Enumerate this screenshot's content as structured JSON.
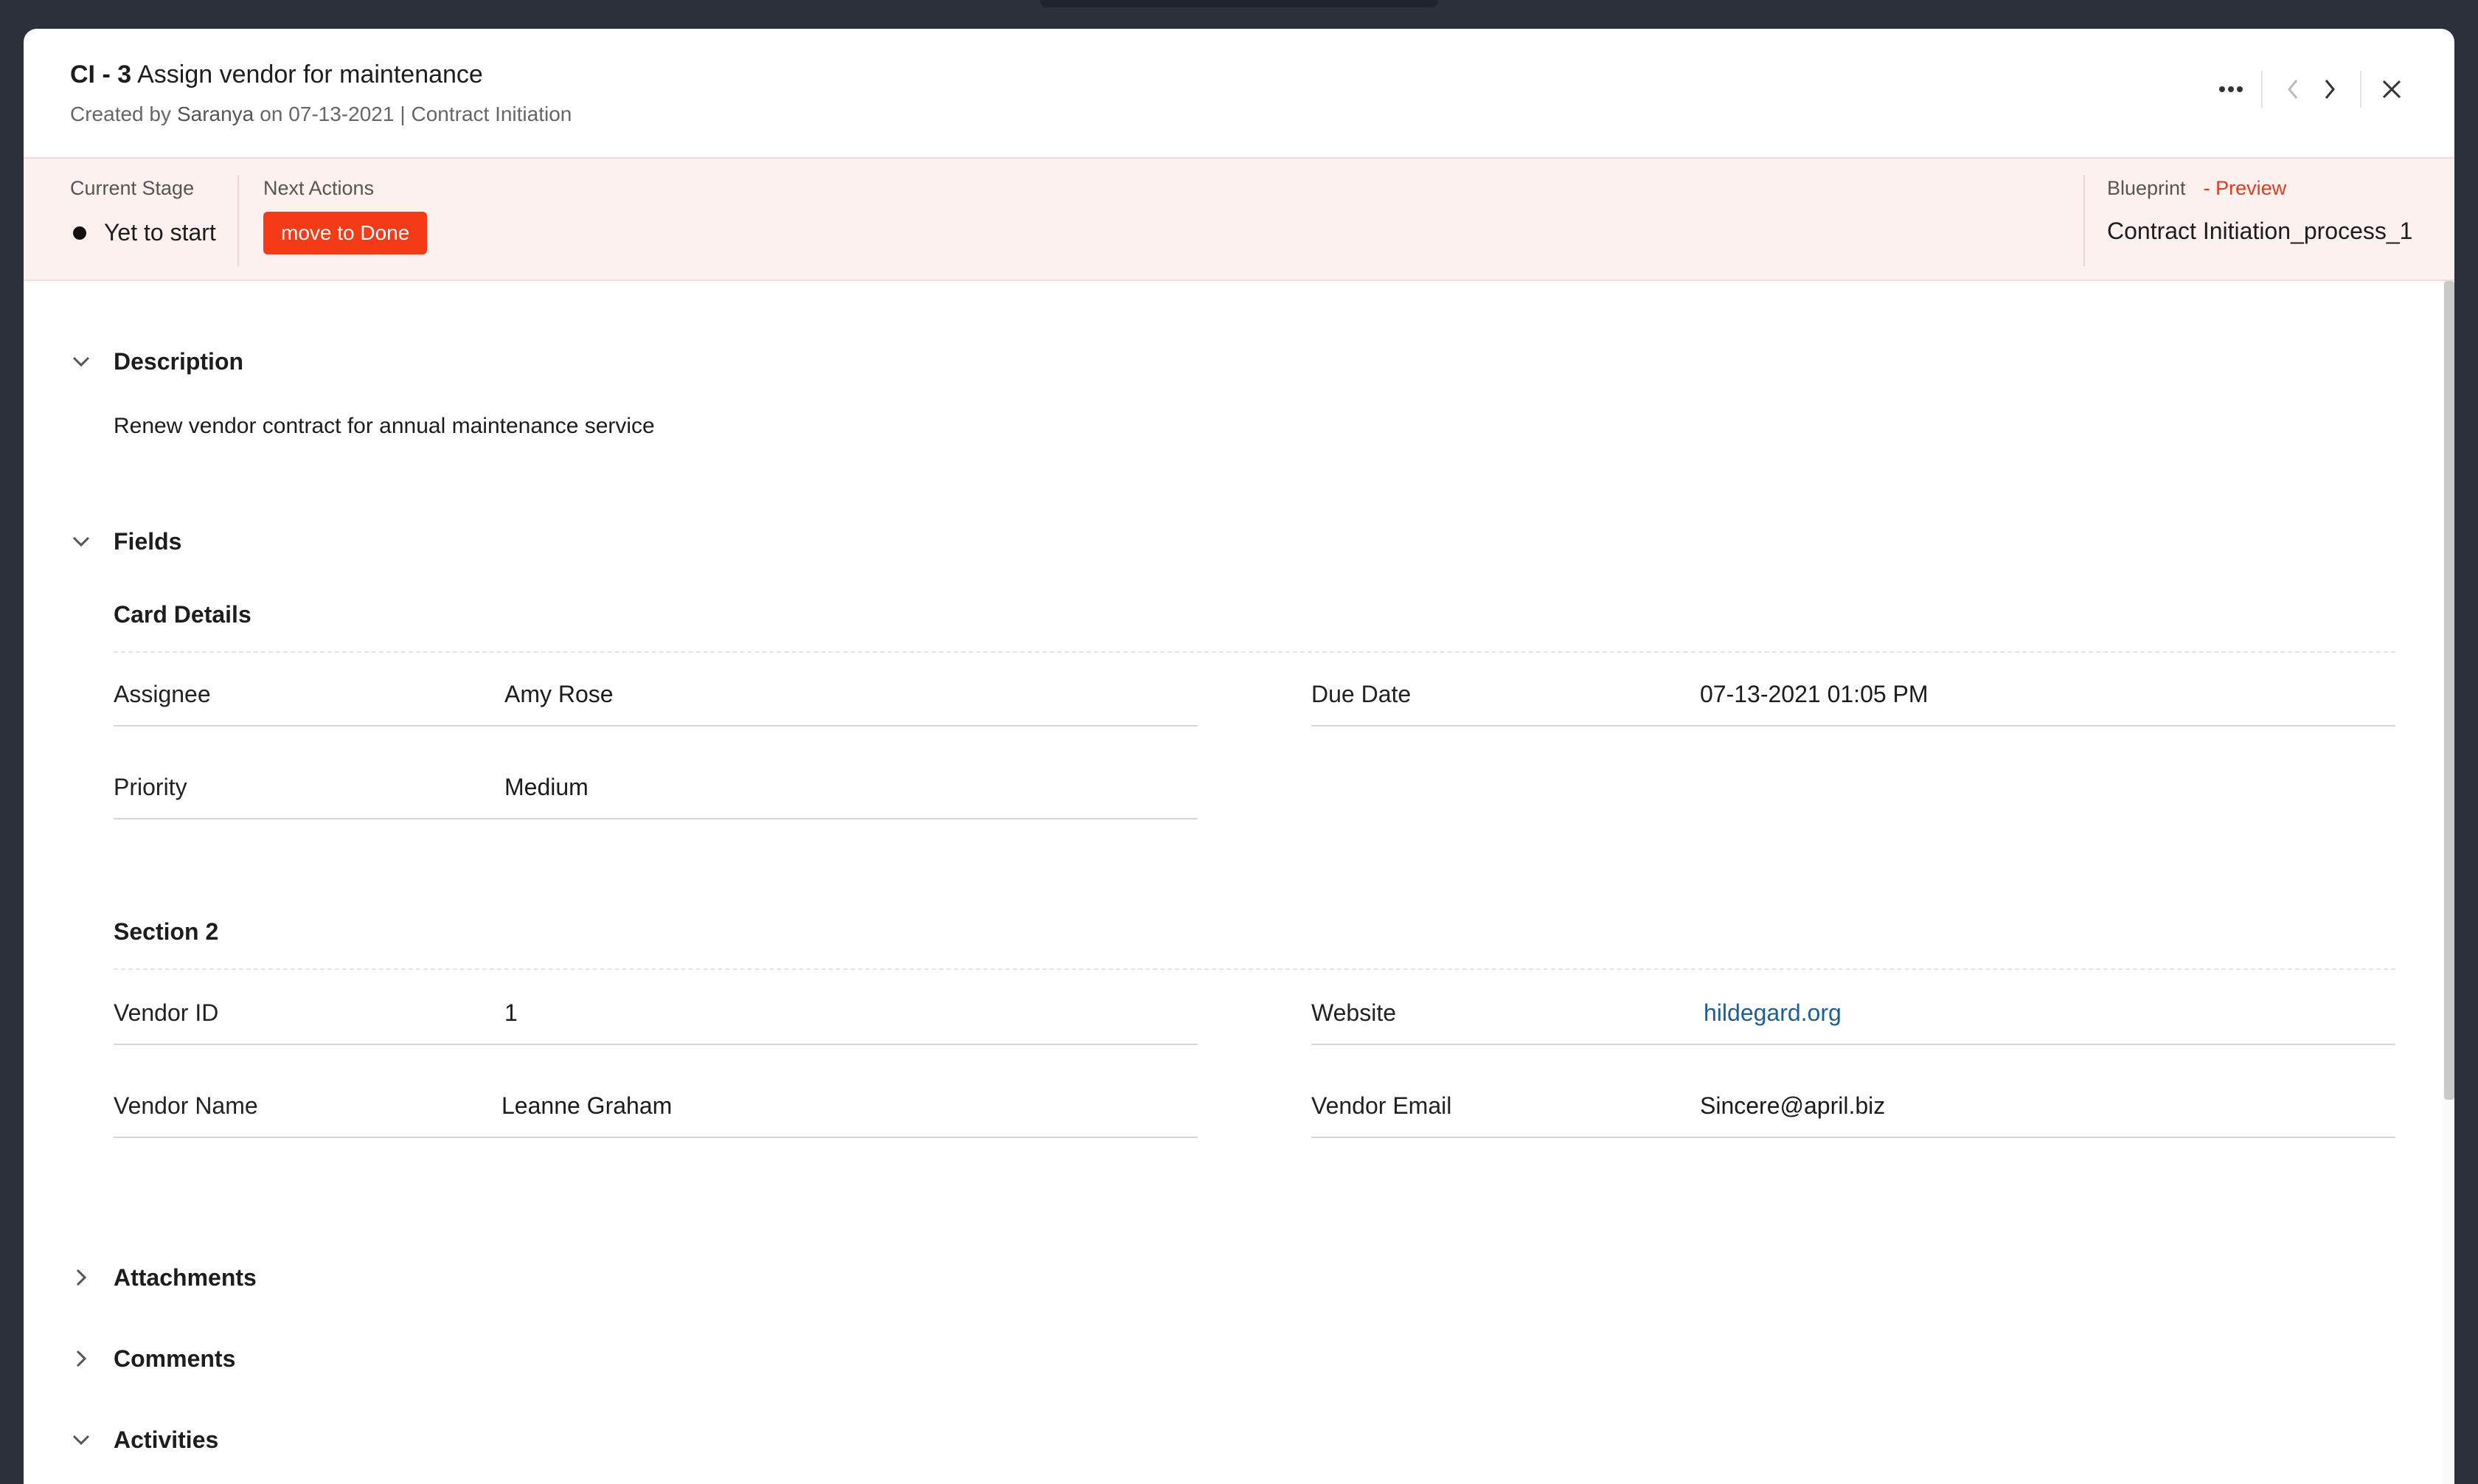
{
  "header": {
    "key": "CI - 3",
    "title": "Assign vendor for maintenance",
    "created_by_label": "Created by",
    "author": "Saranya",
    "date_text": "on 07-13-2021",
    "module": "| Contract Initiation",
    "icons": {
      "more": "more-dots-icon",
      "prev": "chevron-left-icon",
      "next": "chevron-right-icon",
      "close": "close-icon"
    }
  },
  "blueprint_band": {
    "current_stage_label": "Current Stage",
    "current_stage_value": "Yet to start",
    "next_actions_label": "Next Actions",
    "action_button": "move to Done",
    "blueprint_label": "Blueprint",
    "preview_label": "- Preview",
    "blueprint_name": "Contract Initiation_process_1",
    "colors": {
      "band_bg": "#fdf1ef",
      "button_bg": "#f43a16",
      "preview": "#e03c1c"
    }
  },
  "description": {
    "heading": "Description",
    "text": "Renew vendor contract for annual maintenance service"
  },
  "fields": {
    "heading": "Fields",
    "card_details": {
      "heading": "Card Details",
      "assignee_label": "Assignee",
      "assignee_value": "Amy Rose",
      "due_date_label": "Due Date",
      "due_date_value": "07-13-2021 01:05 PM",
      "priority_label": "Priority",
      "priority_value": "Medium"
    },
    "section2": {
      "heading": "Section 2",
      "vendor_id_label": "Vendor ID",
      "vendor_id_value": "1",
      "website_label": "Website",
      "website_value": "hildegard.org",
      "vendor_name_label": "Vendor Name",
      "vendor_name_value": "Leanne Graham",
      "vendor_email_label": "Vendor Email",
      "vendor_email_value": "Sincere@april.biz"
    }
  },
  "collapsed_sections": {
    "attachments": "Attachments",
    "comments": "Comments",
    "activities": "Activities"
  }
}
